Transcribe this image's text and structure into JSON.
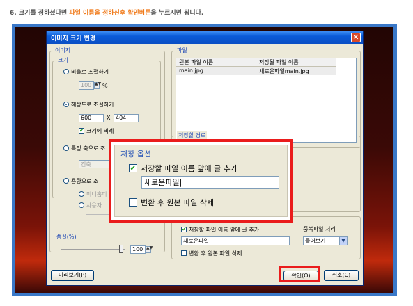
{
  "instruction": {
    "prefix": "6. 크기를 정하셨다면 ",
    "highlight": "파일 이름을 정하신후 확인버튼",
    "suffix": "을 누르시면 됩니다."
  },
  "dialog": {
    "title": "이미지 크기 변경",
    "close_glyph": "✕",
    "image_group": {
      "label": "이미지",
      "size_label": "크기",
      "ratio_option": "비율로 조절하기",
      "ratio_value": "100",
      "ratio_unit": "%",
      "resolution_option": "해상도로 조절하기",
      "width_value": "600",
      "times": "X",
      "height_value": "404",
      "keep_ratio_label": "크기에 비례",
      "axis_option": "특정 축으로 조",
      "axis_select": "긴축",
      "capacity_option": "용량으로 조",
      "mini_option": "미니홈피",
      "user_option": "사용자",
      "quality_label": "품질(%)",
      "quality_value": "100"
    },
    "file_group": {
      "label": "파일",
      "col_original": "원본 파일 이름",
      "col_save": "저장될 파일 이름",
      "rows": [
        {
          "original": "main.jpg",
          "save": "새로운파일main.jpg"
        }
      ]
    },
    "save_path_label": "저장할 경로",
    "save_options": {
      "prefix_label": "저장할 파일 이름 앞에 글 추가",
      "prefix_value": "새로운파일",
      "delete_label": "변환 후 원본 파일 삭제",
      "duplicate_label": "중복파일 처리",
      "duplicate_value": "물어보기"
    },
    "buttons": {
      "preview": "미리보기(P)",
      "ok": "확인(O)",
      "cancel": "취소(C)"
    }
  },
  "zoom": {
    "title": "저장 옵션",
    "prefix_label": "저장할 파일 이름 앞에 글 추가",
    "prefix_value": "새로운파일|",
    "delete_label": "변환 후 원본 파일 삭제"
  }
}
